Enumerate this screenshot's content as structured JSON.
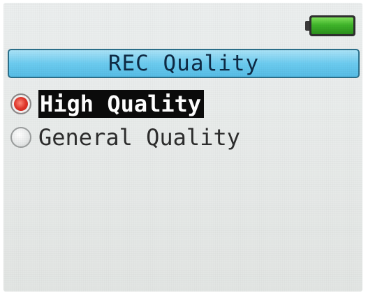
{
  "screen": {
    "title": "REC Quality",
    "battery_icon": "battery-full-icon",
    "options": [
      {
        "label": "High Quality",
        "selected": true,
        "icon": "radio-checked-icon"
      },
      {
        "label": "General Quality",
        "selected": false,
        "icon": "radio-unchecked-icon"
      }
    ]
  },
  "colors": {
    "title_bar": "#6ccbef",
    "battery_fill": "#3fb52a",
    "radio_checked": "#e0352a",
    "selection_highlight": "#0b0b0b"
  }
}
